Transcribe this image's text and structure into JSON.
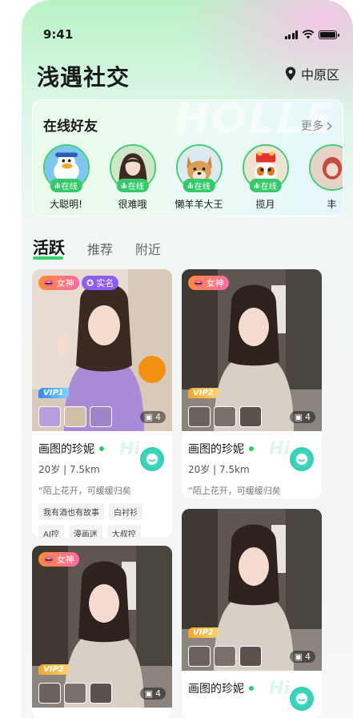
{
  "status_bar": {
    "time": "9:41",
    "signal_icon": "signal-icon",
    "wifi_icon": "wifi-icon",
    "battery_icon": "battery-icon"
  },
  "header": {
    "title": "浅遇社交",
    "location": "中原区",
    "location_icon": "location-pin-icon"
  },
  "friends_card": {
    "title": "在线好友",
    "more": "更多",
    "online_label": "在线",
    "friends": [
      {
        "name": "大聪明!"
      },
      {
        "name": "很难哦"
      },
      {
        "name": "懒羊羊大王"
      },
      {
        "name": "揽月"
      },
      {
        "name": "丰"
      }
    ]
  },
  "tabs": [
    {
      "label": "活跃"
    },
    {
      "label": "推荐"
    },
    {
      "label": "附近"
    }
  ],
  "feed": [
    {
      "gender_tag": "女神",
      "verify_tag": "实名",
      "vip": "VIP1",
      "photo_count": "4",
      "name": "画图的珍妮",
      "age": "20岁",
      "distance": "7.5km",
      "signature": "陌上花开，可缓缓归矣",
      "chips": [
        "我有酒也有故事",
        "白衬衫",
        "AJ控",
        "漫画迷",
        "大叔控"
      ]
    },
    {
      "gender_tag": "女神",
      "vip": "VIP2",
      "photo_count": "4",
      "name": "画图的珍妮",
      "age": "20岁",
      "distance": "7.5km",
      "signature": "陌上花开，可缓缓归矣"
    },
    {
      "gender_tag": "女神",
      "vip": "VIP2",
      "photo_count": "4"
    },
    {
      "vip": "VIP2",
      "photo_count": "4",
      "name": "画图的珍妮"
    }
  ],
  "colors": {
    "accent_green": "#39d36b",
    "online_green": "#36c96a",
    "verify_purple": "#8e5cf6",
    "hi_teal": "#39d0b8"
  }
}
